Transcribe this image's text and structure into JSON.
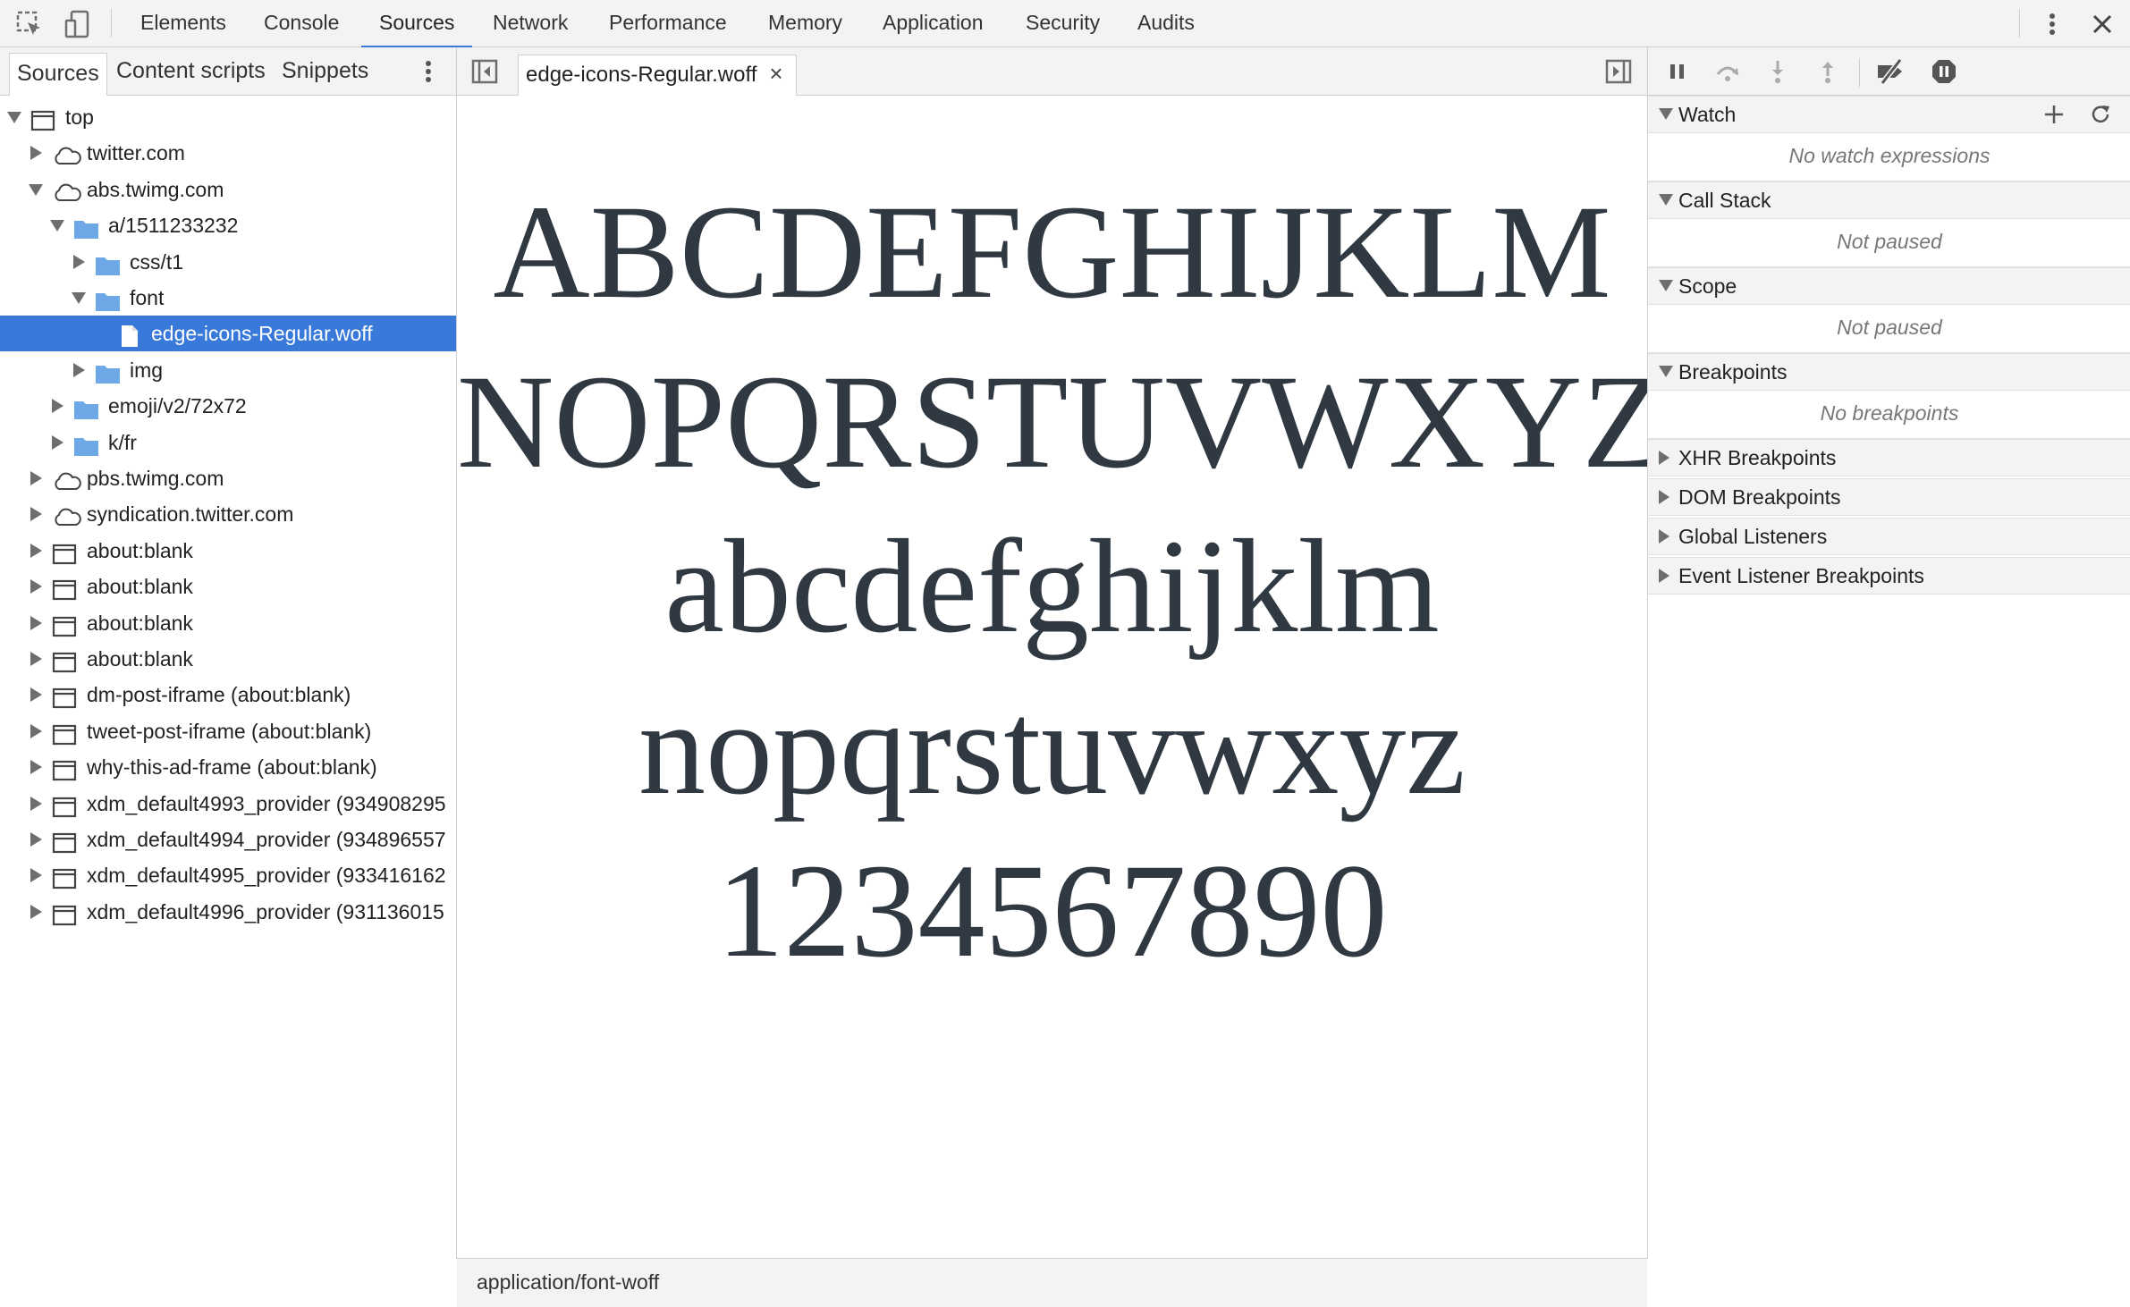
{
  "toolbar": {
    "tabs": [
      "Elements",
      "Console",
      "Sources",
      "Network",
      "Performance",
      "Memory",
      "Application",
      "Security",
      "Audits"
    ],
    "active_tab": "Sources"
  },
  "navigator": {
    "tabs": [
      "Sources",
      "Content scripts",
      "Snippets"
    ],
    "active_tab": "Sources",
    "tree": [
      {
        "label": "top",
        "depth": 0,
        "expanded": true,
        "icon": "frame-icon"
      },
      {
        "label": "twitter.com",
        "depth": 1,
        "expanded": false,
        "icon": "cloud-icon"
      },
      {
        "label": "abs.twimg.com",
        "depth": 1,
        "expanded": true,
        "icon": "cloud-icon"
      },
      {
        "label": "a/1511233232",
        "depth": 2,
        "expanded": true,
        "icon": "folder-icon"
      },
      {
        "label": "css/t1",
        "depth": 3,
        "expanded": false,
        "icon": "folder-icon"
      },
      {
        "label": "font",
        "depth": 3,
        "expanded": true,
        "icon": "folder-icon"
      },
      {
        "label": "edge-icons-Regular.woff",
        "depth": 4,
        "icon": "file-icon",
        "selected": true
      },
      {
        "label": "img",
        "depth": 3,
        "expanded": false,
        "icon": "folder-icon"
      },
      {
        "label": "emoji/v2/72x72",
        "depth": 2,
        "expanded": false,
        "icon": "folder-icon"
      },
      {
        "label": "k/fr",
        "depth": 2,
        "expanded": false,
        "icon": "folder-icon"
      },
      {
        "label": "pbs.twimg.com",
        "depth": 1,
        "expanded": false,
        "icon": "cloud-icon"
      },
      {
        "label": "syndication.twitter.com",
        "depth": 1,
        "expanded": false,
        "icon": "cloud-icon"
      },
      {
        "label": "about:blank",
        "depth": 1,
        "expanded": false,
        "icon": "frame-icon"
      },
      {
        "label": "about:blank",
        "depth": 1,
        "expanded": false,
        "icon": "frame-icon"
      },
      {
        "label": "about:blank",
        "depth": 1,
        "expanded": false,
        "icon": "frame-icon"
      },
      {
        "label": "about:blank",
        "depth": 1,
        "expanded": false,
        "icon": "frame-icon"
      },
      {
        "label": "dm-post-iframe (about:blank)",
        "depth": 1,
        "expanded": false,
        "icon": "frame-icon"
      },
      {
        "label": "tweet-post-iframe (about:blank)",
        "depth": 1,
        "expanded": false,
        "icon": "frame-icon"
      },
      {
        "label": "why-this-ad-frame (about:blank)",
        "depth": 1,
        "expanded": false,
        "icon": "frame-icon"
      },
      {
        "label": "xdm_default4993_provider (934908295",
        "depth": 1,
        "expanded": false,
        "icon": "frame-icon"
      },
      {
        "label": "xdm_default4994_provider (934896557",
        "depth": 1,
        "expanded": false,
        "icon": "frame-icon"
      },
      {
        "label": "xdm_default4995_provider (933416162",
        "depth": 1,
        "expanded": false,
        "icon": "frame-icon"
      },
      {
        "label": "xdm_default4996_provider (931136015",
        "depth": 1,
        "expanded": false,
        "icon": "frame-icon"
      }
    ]
  },
  "editor": {
    "open_file": "edge-icons-Regular.woff",
    "preview_lines": [
      "ABCDEFGHIJKLM",
      "NOPQRSTUVWXYZ",
      "abcdefghijklm",
      "nopqrstuvwxyz",
      "1234567890"
    ],
    "status": "application/font-woff"
  },
  "sidebar": {
    "sections": [
      {
        "title": "Watch",
        "expanded": true,
        "body": "No watch expressions"
      },
      {
        "title": "Call Stack",
        "expanded": true,
        "body": "Not paused"
      },
      {
        "title": "Scope",
        "expanded": true,
        "body": "Not paused"
      },
      {
        "title": "Breakpoints",
        "expanded": true,
        "body": "No breakpoints"
      },
      {
        "title": "XHR Breakpoints",
        "expanded": false
      },
      {
        "title": "DOM Breakpoints",
        "expanded": false
      },
      {
        "title": "Global Listeners",
        "expanded": false
      },
      {
        "title": "Event Listener Breakpoints",
        "expanded": false
      }
    ]
  },
  "colors": {
    "accent": "#3879d9",
    "folder": "#6fa8e6",
    "preview_text": "#303942"
  }
}
